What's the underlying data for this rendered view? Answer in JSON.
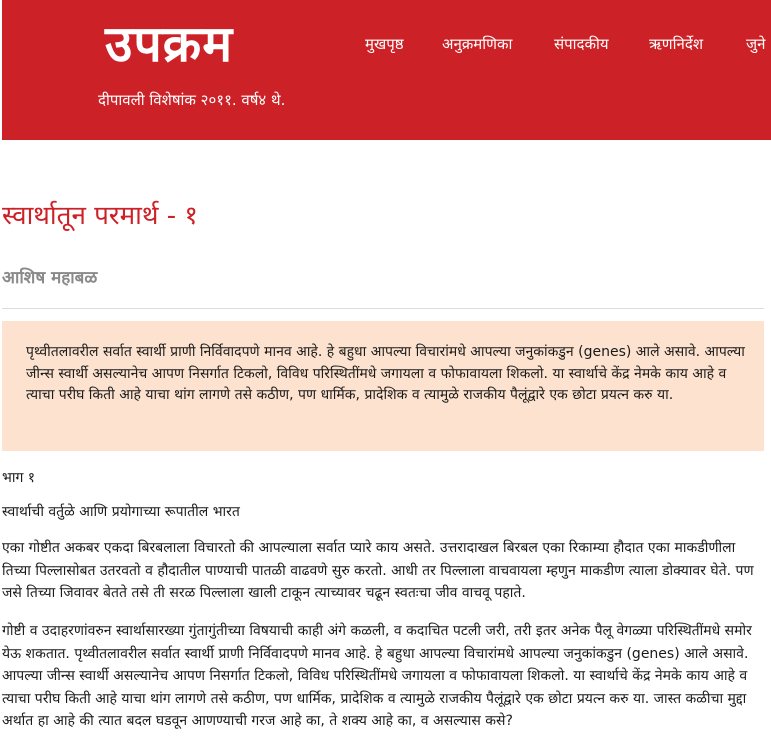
{
  "site": {
    "logo": "उपक्रम",
    "tagline": "दीपावली विशेषांक २०११. वर्ष४ थे."
  },
  "nav": {
    "items": [
      {
        "label": "मुखपृष्ठ"
      },
      {
        "label": "अनुक्रमणिका"
      },
      {
        "label": "संपादकीय"
      },
      {
        "label": "ऋणनिर्देश"
      },
      {
        "label": "जुने"
      }
    ]
  },
  "article": {
    "title": "स्वार्थातून परमार्थ - १",
    "author": "आशिष महाबळ",
    "summary": "पृथ्वीतलावरील सर्वात स्वार्थी प्राणी निर्विवादपणे मानव आहे. हे बहुधा आपल्या विचारांमधे आपल्या जनुकांकडुन (genes) आले असावे. आपल्या जीन्स स्वार्थी असल्यानेच आपण निसर्गात टिकलो, विविध परिस्थितींमधे जगायला व फोफावायला शिकलो. या स्वार्थाचे केंद्र नेमके काय आहे व त्याचा परीघ किती आहे याचा थांग लागणे तसे कठीण, पण धार्मिक, प्रादेशिक व त्यामुळे राजकीय पैलूंद्वारे एक छोटा प्रयत्न करु या.",
    "part_label": "भाग १",
    "section_heading": "स्वार्थाची वर्तुळे आणि प्रयोगाच्या रूपातील भारत",
    "paragraphs": [
      "एका गोष्टीत अकबर एकदा बिरबलाला विचारतो की आपल्याला सर्वात प्यारे काय असते. उत्तरादाखल बिरबल एका रिकाम्या हौदात एका माकडीणीला तिच्या पिल्लासोबत उतरवतो व हौदातील पाण्याची पातळी वाढवणे सुरु करतो. आधी तर पिल्लाला वाचवायला म्हणुन माकडीण त्याला डोक्यावर घेते. पण जसे तिच्या जिवावर बेतते तसे ती सरळ पिल्लाला खाली टाकून त्याच्यावर चढून स्वतःचा जीव वाचवू पहाते.",
      "गोष्टी व उदाहरणांवरुन स्वार्थासारख्या गुंतागुंतीच्या विषयाची काही अंगे कळली, व कदाचित पटली जरी, तरी इतर अनेक पैलू वेगळ्या परिस्थितींमधे समोर येऊ शकतात. पृथ्वीतलावरील सर्वात स्वार्थी प्राणी निर्विवादपणे मानव आहे. हे बहुधा आपल्या विचारांमधे आपल्या जनुकांकडुन (genes) आले असावे. आपल्या जीन्स स्वार्थी असल्यानेच आपण निसर्गात टिकलो, विविध परिस्थितींमधे जगायला व फोफावायला शिकलो. या स्वार्थाचे केंद्र नेमके काय आहे व त्याचा परीघ किती आहे याचा थांग लागणे तसे कठीण, पण धार्मिक, प्रादेशिक व त्यामुळे राजकीय पैलूंद्वारे एक छोटा प्रयत्न करु या. जास्त कळीचा मुद्दा अर्थात हा आहे की त्यात बदल घडवून आणण्याची गरज आहे का, ते शक्य आहे का, व असल्यास कसे?"
    ]
  },
  "colors": {
    "header_bg": "#cc2126",
    "title": "#cc2126",
    "summary_bg": "#fde3cf",
    "author": "#8a8a8a"
  }
}
